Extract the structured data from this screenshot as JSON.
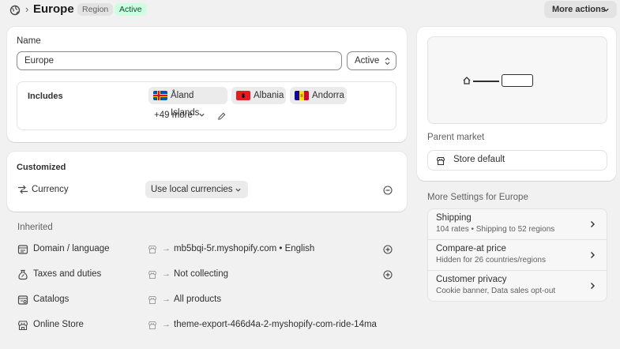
{
  "header": {
    "title": "Europe",
    "badge_region": "Region",
    "badge_status": "Active",
    "more_actions": "More actions"
  },
  "name_card": {
    "label": "Name",
    "value": "Europe",
    "status_select": "Active",
    "includes_label": "Includes",
    "countries": [
      {
        "name": "Åland Islands"
      },
      {
        "name": "Albania"
      },
      {
        "name": "Andorra"
      }
    ],
    "more_link": "+49 more"
  },
  "customized": {
    "title": "Customized",
    "currency_label": "Currency",
    "currency_value": "Use local currencies"
  },
  "inherited": {
    "title": "Inherited",
    "rows": [
      {
        "label": "Domain / language",
        "value": "mb5bqi-5r.myshopify.com • English"
      },
      {
        "label": "Taxes and duties",
        "value": "Not collecting"
      },
      {
        "label": "Catalogs",
        "value": "All products"
      },
      {
        "label": "Online Store",
        "value": "theme-export-466d4a-2-myshopify-com-ride-14ma"
      }
    ]
  },
  "side": {
    "parent_market_label": "Parent market",
    "parent_market_value": "Store default",
    "more_settings_title": "More Settings for Europe",
    "settings": [
      {
        "title": "Shipping",
        "subtitle": "104 rates • Shipping to 52 regions"
      },
      {
        "title": "Compare-at price",
        "subtitle": "Hidden for 26 countries/regions"
      },
      {
        "title": "Customer privacy",
        "subtitle": "Cookie banner, Data sales opt-out"
      }
    ]
  },
  "colors": {
    "background": "#f1f1f1",
    "badge_active_bg": "#cdfee1",
    "badge_active_text": "#0c5132"
  }
}
